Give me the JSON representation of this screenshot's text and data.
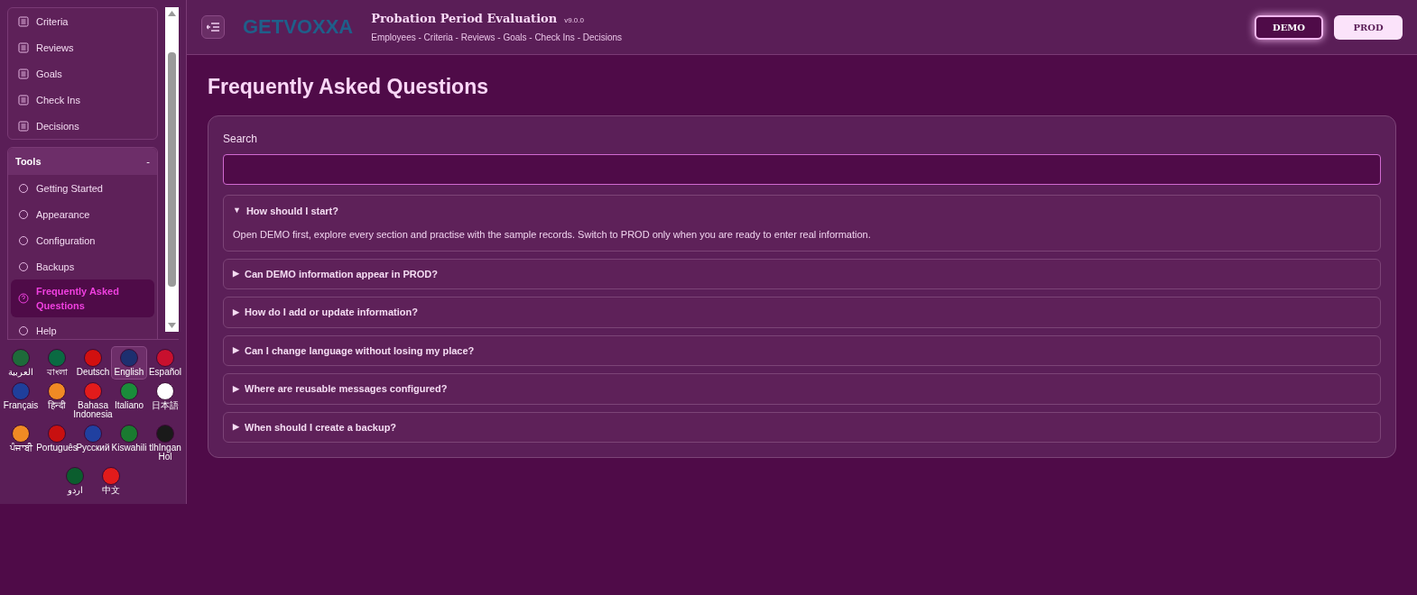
{
  "sidebar": {
    "sections": [
      {
        "items": [
          {
            "label": "Criteria",
            "selected": false
          },
          {
            "label": "Reviews",
            "selected": false
          },
          {
            "label": "Goals",
            "selected": false
          },
          {
            "label": "Check Ins",
            "selected": false
          },
          {
            "label": "Decisions",
            "selected": false
          }
        ]
      },
      {
        "title": "Tools",
        "toggle": "-",
        "items": [
          {
            "label": "Getting Started",
            "selected": false
          },
          {
            "label": "Appearance",
            "selected": false
          },
          {
            "label": "Configuration",
            "selected": false
          },
          {
            "label": "Backups",
            "selected": false
          },
          {
            "label": "Frequently Asked Questions",
            "selected": true
          },
          {
            "label": "Help",
            "selected": false
          }
        ]
      }
    ],
    "languages": [
      {
        "label": "العربية",
        "color": "#1e6b3a",
        "selected": false
      },
      {
        "label": "বাংলা",
        "color": "#0a6a42",
        "selected": false
      },
      {
        "label": "Deutsch",
        "color": "#d21010",
        "selected": false
      },
      {
        "label": "English",
        "color": "#1d2f6f",
        "selected": true
      },
      {
        "label": "Español",
        "color": "#c8102e",
        "selected": false
      },
      {
        "label": "Français",
        "color": "#1f3f9b",
        "selected": false
      },
      {
        "label": "हिन्दी",
        "color": "#f08a24",
        "selected": false
      },
      {
        "label": "Bahasa Indonesia",
        "color": "#e21b1b",
        "selected": false
      },
      {
        "label": "Italiano",
        "color": "#1a8c3a",
        "selected": false
      },
      {
        "label": "日本語",
        "color": "#ffffff",
        "selected": false
      },
      {
        "label": "ਪੰਜਾਬੀ",
        "color": "#f08a24",
        "selected": false
      },
      {
        "label": "Português",
        "color": "#c81010",
        "selected": false
      },
      {
        "label": "Русский",
        "color": "#2040a0",
        "selected": false
      },
      {
        "label": "Kiswahili",
        "color": "#1a7a30",
        "selected": false
      },
      {
        "label": "tlhIngan Hol",
        "color": "#1a1a1a",
        "selected": false
      },
      {
        "label": "اردو",
        "color": "#0b5d2e",
        "selected": false
      },
      {
        "label": "中文",
        "color": "#e21b1b",
        "selected": false
      }
    ]
  },
  "header": {
    "logo": "GETVOXXA",
    "title": "Probation Period Evaluation",
    "version": "v9.0.0",
    "subtitle": "Employees - Criteria - Reviews - Goals - Check Ins - Decisions",
    "modes": [
      {
        "label": "DEMO",
        "selected": true
      },
      {
        "label": "PROD",
        "selected": false
      }
    ]
  },
  "page": {
    "title": "Frequently Asked Questions",
    "search": {
      "label": "Search"
    },
    "faqs": [
      {
        "marker": "▼",
        "question": "How should I start?",
        "expanded": true,
        "answer": "Open DEMO first, explore every section and practise with the sample records. Switch to PROD only when you are ready to enter real information."
      },
      {
        "marker": "▶",
        "question": "Can DEMO information appear in PROD?",
        "expanded": false
      },
      {
        "marker": "▶",
        "question": "How do I add or update information?",
        "expanded": false
      },
      {
        "marker": "▶",
        "question": "Can I change language without losing my place?",
        "expanded": false
      },
      {
        "marker": "▶",
        "question": "Where are reusable messages configured?",
        "expanded": false
      },
      {
        "marker": "▶",
        "question": "When should I create a backup?",
        "expanded": false
      }
    ]
  }
}
